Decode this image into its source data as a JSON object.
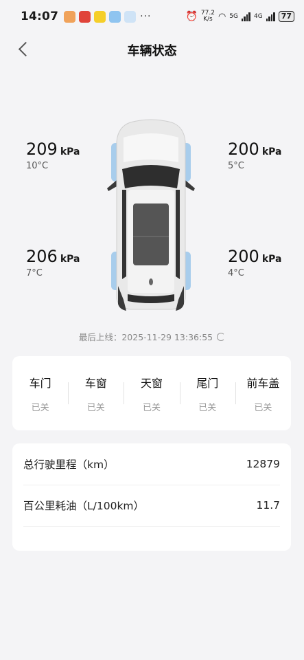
{
  "status_bar": {
    "time": "14:07",
    "dots": "···",
    "net_speed_value": "77.2",
    "net_speed_unit": "K/s",
    "sig1_label": "5G",
    "sig2_label": "4G",
    "battery": "77"
  },
  "header": {
    "title": "车辆状态"
  },
  "tires": {
    "front_left": {
      "pressure": "209",
      "unit": "kPa",
      "temp": "10°C"
    },
    "front_right": {
      "pressure": "200",
      "unit": "kPa",
      "temp": "5°C"
    },
    "rear_left": {
      "pressure": "206",
      "unit": "kPa",
      "temp": "7°C"
    },
    "rear_right": {
      "pressure": "200",
      "unit": "kPa",
      "temp": "4°C"
    }
  },
  "last_online": {
    "text": "最后上线：2025-11-29 13:36:55"
  },
  "openings": [
    {
      "label": "车门",
      "value": "已关"
    },
    {
      "label": "车窗",
      "value": "已关"
    },
    {
      "label": "天窗",
      "value": "已关"
    },
    {
      "label": "尾门",
      "value": "已关"
    },
    {
      "label": "前车盖",
      "value": "已关"
    }
  ],
  "stats": [
    {
      "label": "总行驶里程（km）",
      "value": "12879"
    },
    {
      "label": "百公里耗油（L/100km）",
      "value": "11.7"
    }
  ]
}
